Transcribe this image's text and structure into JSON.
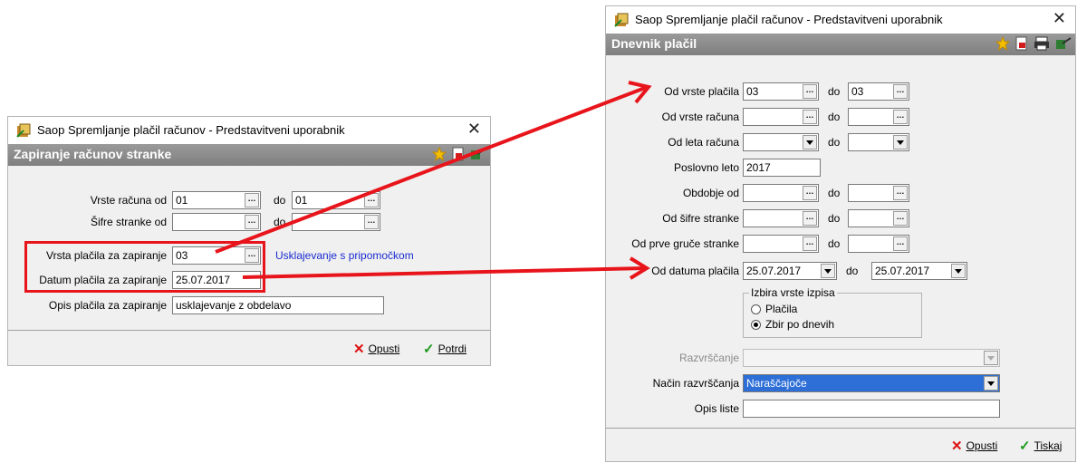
{
  "left_window": {
    "title": "Saop Spremljanje plačil računov - Predstavitveni uporabnik",
    "header": "Zapiranje računov stranke",
    "fields": {
      "vrsta_racuna_label": "Vrste računa od",
      "vrsta_racuna_from": "01",
      "vrsta_racuna_do": "do",
      "vrsta_racuna_to": "01",
      "sifre_label": "Šifre stranke od",
      "sifre_from": "",
      "sifre_do": "do",
      "sifre_to": "",
      "vrsta_placila_label": "Vrsta plačila za zapiranje",
      "vrsta_placila_value": "03",
      "link": "Usklajevanje s pripomočkom",
      "datum_label": "Datum plačila za zapiranje",
      "datum_value": "25.07.2017",
      "opis_label": "Opis plačila za zapiranje",
      "opis_value": "usklajevanje z obdelavo"
    },
    "buttons": {
      "cancel": "Opusti",
      "confirm": "Potrdi"
    }
  },
  "right_window": {
    "title": "Saop Spremljanje plačil računov - Predstavitveni uporabnik",
    "header": "Dnevnik plačil",
    "rows": [
      {
        "label": "Od vrste plačila",
        "from": "03",
        "do": "do",
        "to": "03"
      },
      {
        "label": "Od vrste računa",
        "from": "",
        "do": "do",
        "to": ""
      },
      {
        "label": "Od leta računa",
        "from": "",
        "do": "do",
        "to": ""
      },
      {
        "label": "Poslovno leto",
        "value": "2017"
      },
      {
        "label": "Obdobje od",
        "from": "",
        "do": "do",
        "to": ""
      },
      {
        "label": "Od šifre stranke",
        "from": "",
        "do": "do",
        "to": ""
      },
      {
        "label": "Od prve gruče stranke",
        "from": "",
        "do": "do",
        "to": ""
      },
      {
        "label": "Od datuma plačila",
        "from": "25.07.2017",
        "do": "do",
        "to": "25.07.2017"
      }
    ],
    "izpis": {
      "legend": "Izbira vrste izpisa",
      "options": [
        "Plačila",
        "Zbir po dnevih"
      ],
      "selected": "Zbir po dnevih"
    },
    "razvrscanje_label": "Razvrščanje",
    "razvrscanje_value": "",
    "nacin_label": "Način razvrščanja",
    "nacin_value": "Naraščajoče",
    "opis_label": "Opis liste",
    "opis_value": "",
    "buttons": {
      "cancel": "Opusti",
      "print": "Tiskaj"
    }
  },
  "colors": {
    "highlight": "#e8141b",
    "header": "#8c8c8c",
    "link": "#1a2bd0",
    "selection": "#2d6fd6"
  }
}
